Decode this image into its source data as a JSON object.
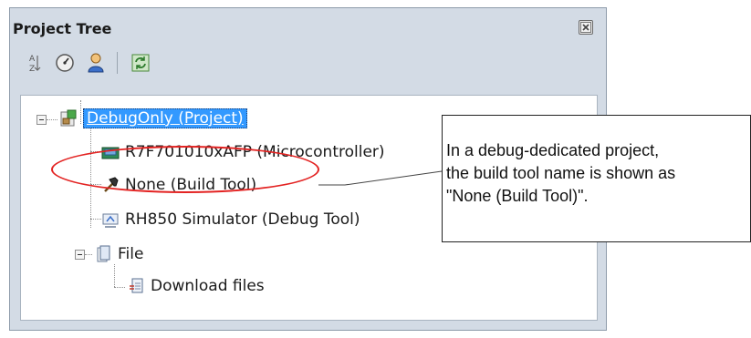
{
  "panel": {
    "title": "Project Tree",
    "close_icon": "close-icon"
  },
  "toolbar": {
    "items": [
      "sort-icon",
      "gauge-icon",
      "user-icon",
      "refresh-icon"
    ]
  },
  "tree": {
    "project": "DebugOnly (Project)",
    "microcontroller": "R7F701010xAFP (Microcontroller)",
    "build_tool": "None (Build Tool)",
    "debug_tool": "RH850 Simulator (Debug Tool)",
    "file_folder": "File",
    "download_files": "Download files"
  },
  "annotation": {
    "line1": "In a debug-dedicated project,",
    "line2": "the build tool name is shown as",
    "line3": "\"None (Build Tool)\"."
  },
  "colors": {
    "panel_bg": "#d3dbe5",
    "selection": "#3399ff",
    "highlight_ellipse": "#e32322"
  }
}
